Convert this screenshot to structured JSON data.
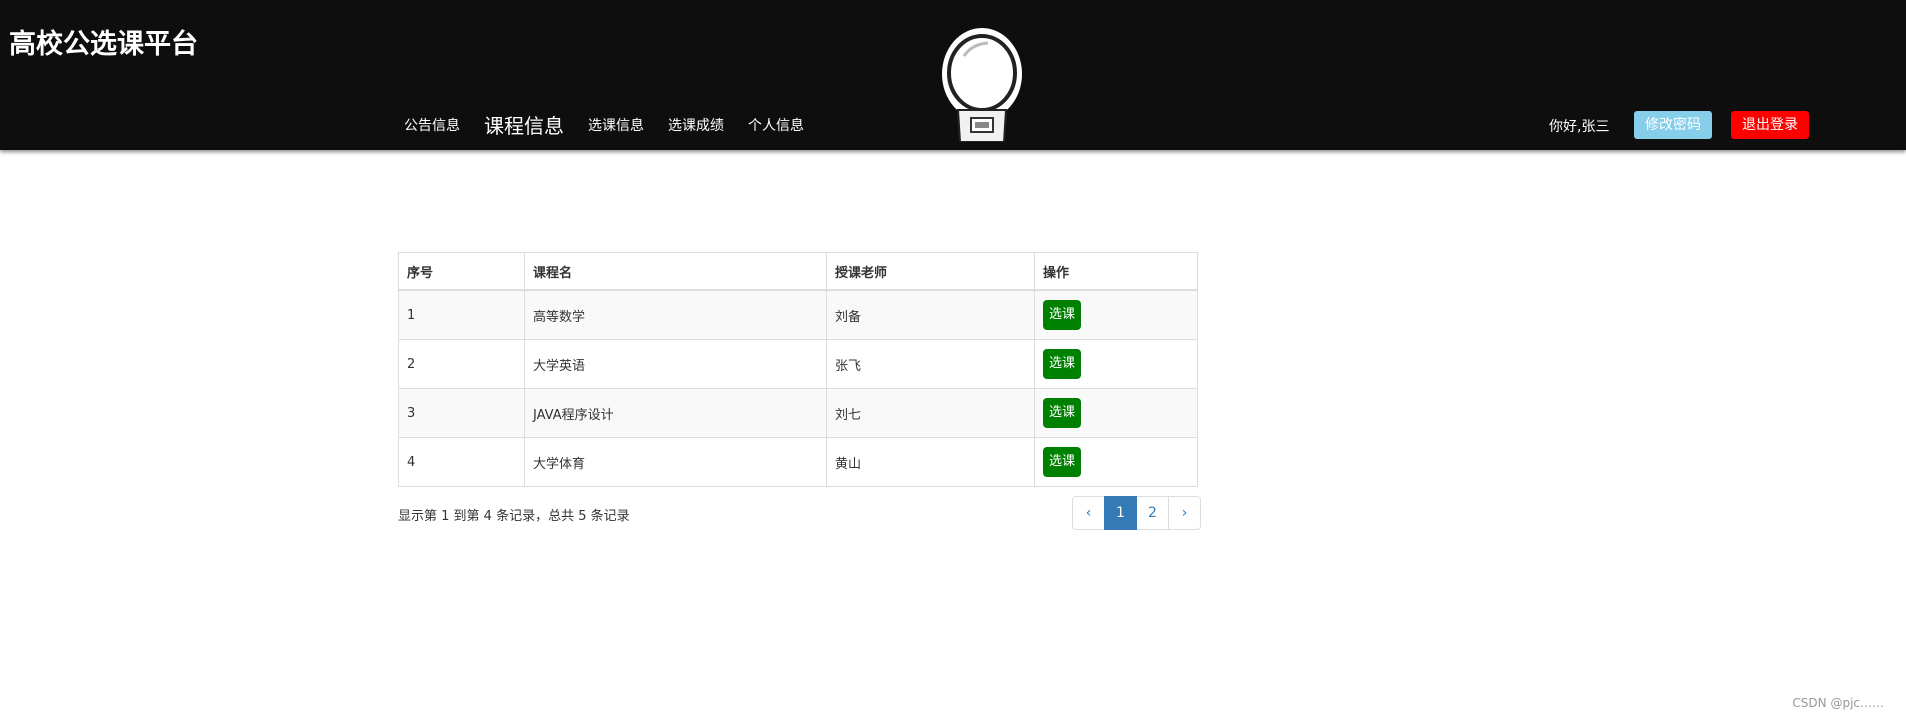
{
  "header": {
    "brand": "高校公选课平台",
    "nav": [
      {
        "label": "公告信息"
      },
      {
        "label": "课程信息",
        "active": true
      },
      {
        "label": "选课信息"
      },
      {
        "label": "选课成绩"
      },
      {
        "label": "个人信息"
      }
    ],
    "greeting": "你好,张三",
    "change_password": "修改密码",
    "logout": "退出登录",
    "mascot_icon": "astronaut-robot-icon"
  },
  "table": {
    "headers": [
      "序号",
      "课程名",
      "授课老师",
      "操作"
    ],
    "rows": [
      {
        "id": "1",
        "course": "高等数学",
        "teacher": "刘备",
        "action": "选课"
      },
      {
        "id": "2",
        "course": "大学英语",
        "teacher": "张飞",
        "action": "选课"
      },
      {
        "id": "3",
        "course": "JAVA程序设计",
        "teacher": "刘七",
        "action": "选课"
      },
      {
        "id": "4",
        "course": "大学体育",
        "teacher": "黄山",
        "action": "选课"
      }
    ]
  },
  "footer": {
    "summary": "显示第 1 到第 4 条记录，总共 5 条记录",
    "pagination": {
      "prev": "‹",
      "pages": [
        "1",
        "2"
      ],
      "current": "1",
      "next": "›"
    }
  },
  "watermark": "CSDN @pjc……",
  "colors": {
    "header_bg": "#0e0e0e",
    "change_password_bg": "#87ceeb",
    "logout_bg": "#ff0000",
    "select_button_bg": "#008000",
    "pagination_active": "#337ab7"
  }
}
